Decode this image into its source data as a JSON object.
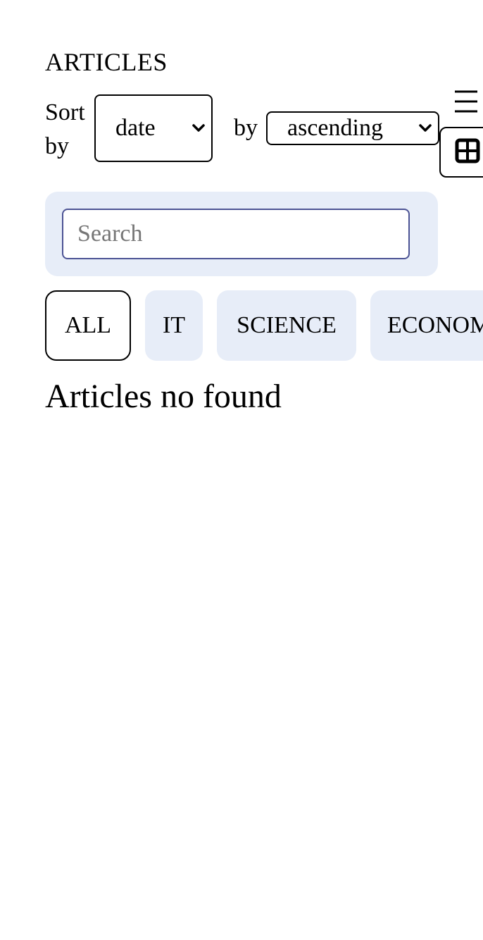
{
  "page": {
    "title": "ARTICLES"
  },
  "sort": {
    "label": "Sort by",
    "field_value": "date",
    "order_label": "by",
    "order_value": "ascending"
  },
  "view_toggle": {
    "list_icon": "hamburger-list-icon",
    "grid_icon": "grid-view-icon"
  },
  "search": {
    "placeholder": "Search",
    "value": ""
  },
  "tabs": [
    {
      "label": "ALL",
      "active": true
    },
    {
      "label": "IT",
      "active": false
    },
    {
      "label": "SCIENCE",
      "active": false
    },
    {
      "label": "ECONOMICS",
      "active": false
    }
  ],
  "content": {
    "empty_message": "Articles no found"
  },
  "colors": {
    "tab_background": "#e7edf8",
    "search_border": "#4c5394"
  }
}
